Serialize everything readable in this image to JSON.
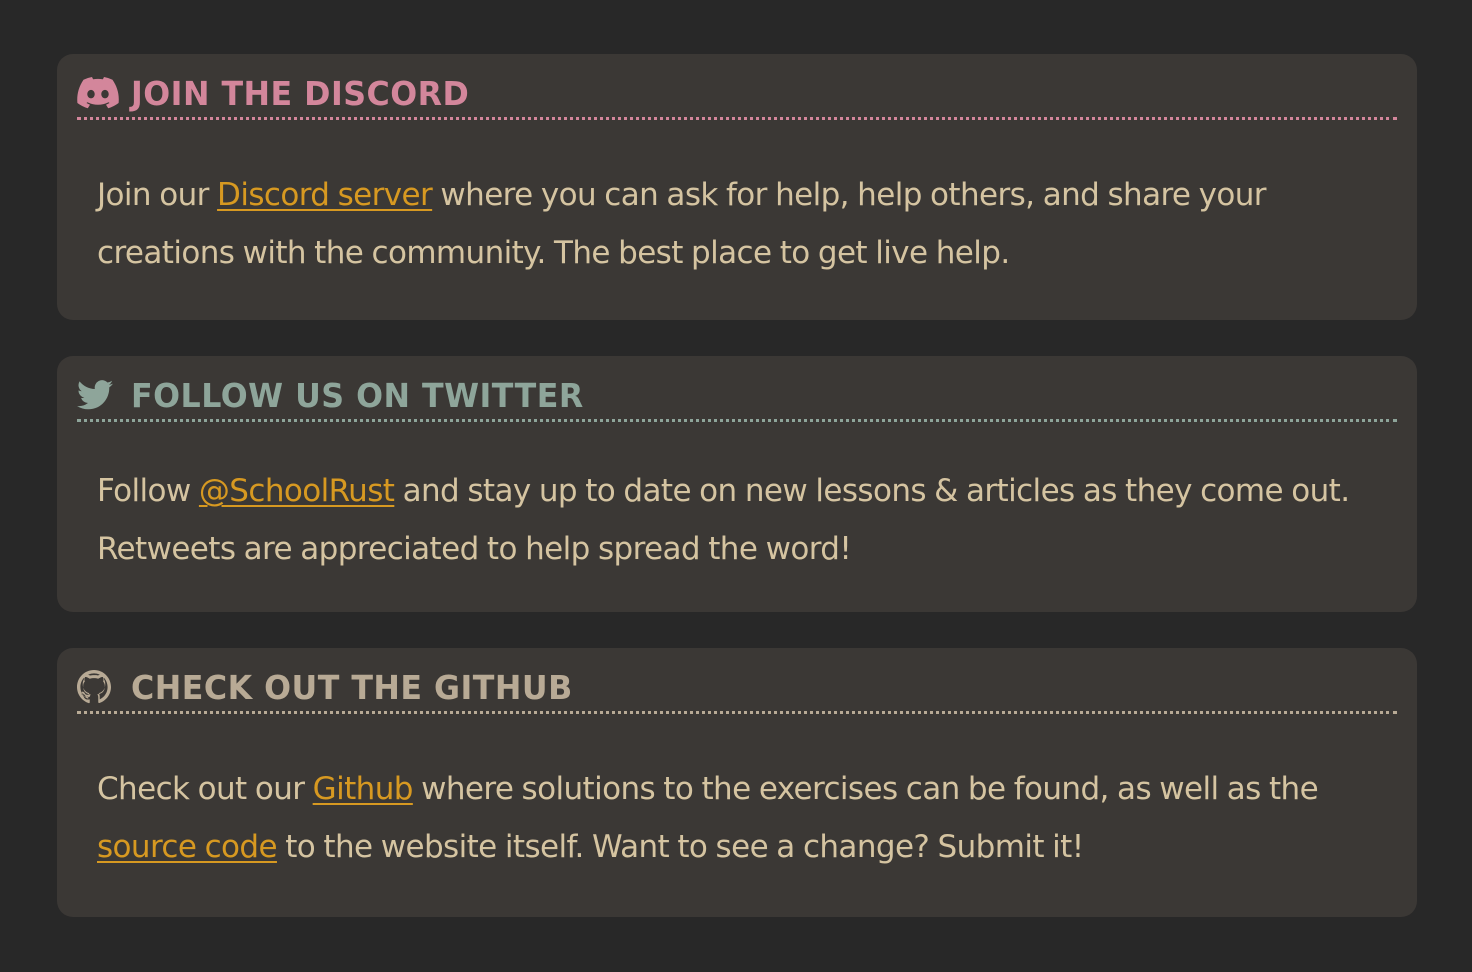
{
  "colors": {
    "background": "#282828",
    "card": "#3b3835",
    "body_text": "#d5c4a1",
    "link": "#d79921",
    "discord_accent": "#d3869b",
    "twitter_accent": "#8ea59a",
    "github_accent": "#b8aa95"
  },
  "discord": {
    "icon": "discord-icon",
    "title": "Join the Discord",
    "text_before": "Join our ",
    "link": "Discord server",
    "text_after": " where you can ask for help, help others, and share your creations with the community. The best place to get live help."
  },
  "twitter": {
    "icon": "twitter-icon",
    "title": "Follow us on Twitter",
    "text_before": "Follow ",
    "link": "@SchoolRust",
    "text_after": " and stay up to date on new lessons & articles as they come out. Retweets are appreciated to help spread the word!"
  },
  "github": {
    "icon": "github-icon",
    "title": "Check out the Github",
    "text_before": "Check out our ",
    "link1": "Github",
    "text_middle": " where solutions to the exercises can be found, as well as the ",
    "link2": "source code",
    "text_after": " to the website itself. Want to see a change? Submit it!"
  }
}
